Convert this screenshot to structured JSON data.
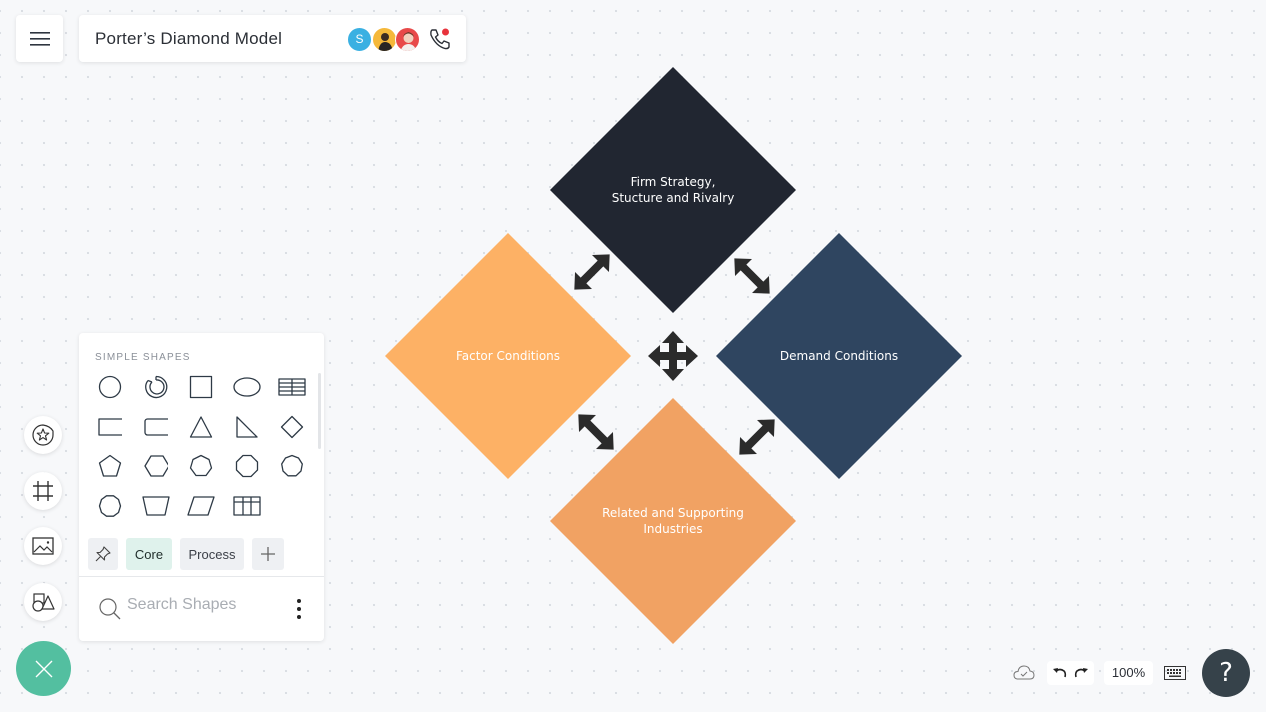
{
  "header": {
    "menu_icon": "hamburger-icon",
    "title": "Porter’s Diamond Model",
    "collaborators": [
      {
        "type": "initial",
        "label": "S",
        "color": "#3ab0e2"
      },
      {
        "type": "photo",
        "color": "#f5b83a"
      },
      {
        "type": "photo",
        "color": "#e84a4a"
      }
    ],
    "call_icon": "phone-icon",
    "call_indicator_color": "#e8333c"
  },
  "diagram": {
    "nodes": [
      {
        "id": "top",
        "label_lines": [
          "Firm Strategy,",
          "Stucture and Rivalry"
        ],
        "color": "#212631"
      },
      {
        "id": "left",
        "label_lines": [
          "Factor Conditions"
        ],
        "color": "#fdb165"
      },
      {
        "id": "right",
        "label_lines": [
          "Demand Conditions"
        ],
        "color": "#2f4560"
      },
      {
        "id": "bottom",
        "label_lines": [
          "Related and Supporting",
          "Industries"
        ],
        "color": "#f1a263"
      }
    ],
    "connectors": [
      "top-left",
      "top-right",
      "bottom-left",
      "bottom-right"
    ],
    "center_icon": "move-arrows-icon",
    "arrow_color": "#2b2b2b"
  },
  "shape_panel": {
    "heading": "SIMPLE SHAPES",
    "shapes": [
      "circle",
      "donut",
      "square",
      "ellipse",
      "table",
      "rectangle",
      "rounded-rectangle",
      "triangle",
      "right-triangle",
      "diamond",
      "pentagon",
      "hexagon",
      "heptagon",
      "octagon",
      "nonagon",
      "decagon",
      "trapezoid",
      "parallelogram",
      "grid"
    ],
    "tabs": [
      {
        "icon": "pin-icon"
      },
      {
        "label": "Core",
        "active": true
      },
      {
        "label": "Process",
        "active": false
      },
      {
        "icon": "plus-icon"
      }
    ],
    "search": {
      "placeholder": "Search Shapes",
      "value": ""
    }
  },
  "left_toolbar": [
    "sticker-icon",
    "frame-icon",
    "image-icon",
    "shapes-icon"
  ],
  "fab_icon": "close-icon",
  "bottom_bar": {
    "cloud_status_icon": "cloud-check-icon",
    "undo_icon": "undo-icon",
    "redo_icon": "redo-icon",
    "zoom": "100%",
    "keyboard_icon": "keyboard-icon",
    "help_label": "?"
  }
}
